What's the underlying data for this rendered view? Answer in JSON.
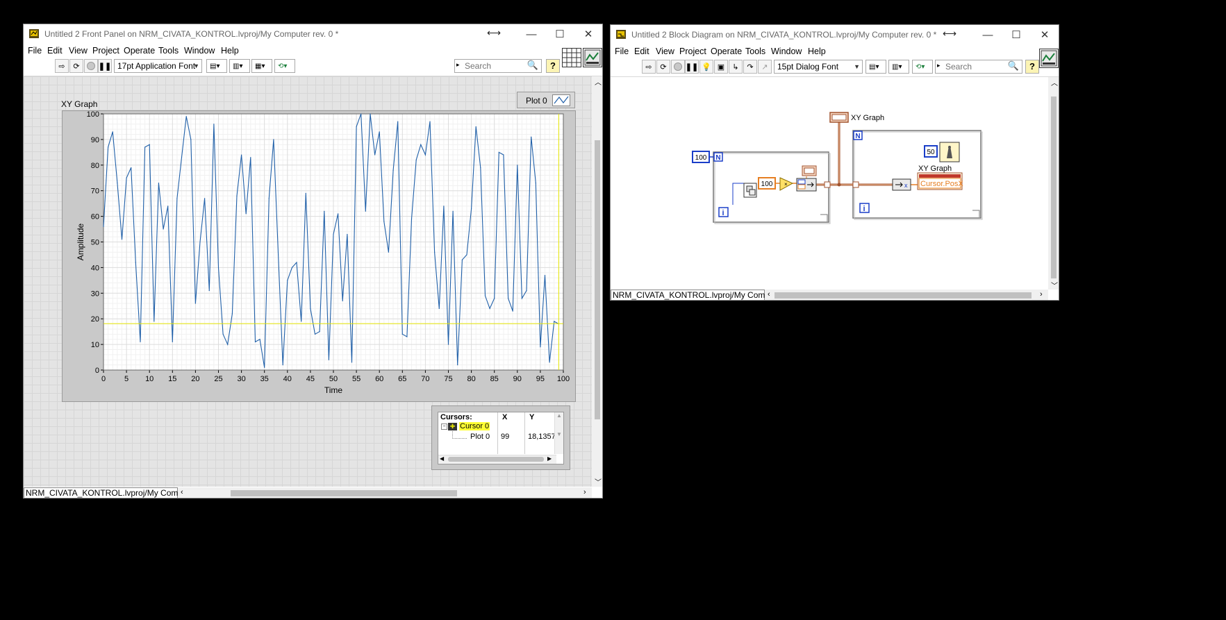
{
  "front_panel": {
    "title": "Untitled 2 Front Panel on NRM_CIVATA_KONTROL.lvproj/My Computer rev. 0 *",
    "menu": [
      "File",
      "Edit",
      "View",
      "Project",
      "Operate",
      "Tools",
      "Window",
      "Help"
    ],
    "font_dropdown": "17pt Application Font",
    "search_placeholder": "Search",
    "status_path": "NRM_CIVATA_KONTROL.lvproj/My Computer",
    "graph": {
      "caption": "XY Graph",
      "legend_plot": "Plot 0",
      "xlabel": "Time",
      "ylabel": "Amplitude",
      "cursor_x": 99,
      "cursor_y": 18.1357
    },
    "cursor_table": {
      "header": [
        "Cursors:",
        "X",
        "Y"
      ],
      "cursor_name": "Cursor 0",
      "plot_name": "Plot 0",
      "x_value": "99",
      "y_value": "18,1357"
    }
  },
  "block_diagram": {
    "title": "Untitled 2 Block Diagram on NRM_CIVATA_KONTROL.lvproj/My Computer rev. 0 *",
    "menu": [
      "File",
      "Edit",
      "View",
      "Project",
      "Operate",
      "Tools",
      "Window",
      "Help"
    ],
    "font_dropdown": "15pt Dialog Font",
    "search_placeholder": "Search",
    "status_path": "NRM_CIVATA_KONTROL.lvproj/My Computer",
    "loop1_count": "100",
    "loop_n": "N",
    "loop_i": "i",
    "multiplier_const": "100",
    "wait_const": "50",
    "graph_terminal_label": "XY Graph",
    "property_node_label": "XY Graph",
    "property_node_item": "Cursor.PosX"
  },
  "chart_data": {
    "type": "line",
    "xlabel": "Time",
    "ylabel": "Amplitude",
    "xlim": [
      0,
      100
    ],
    "ylim": [
      0,
      100
    ],
    "x_ticks": [
      0,
      5,
      10,
      15,
      20,
      25,
      30,
      35,
      40,
      45,
      50,
      55,
      60,
      65,
      70,
      75,
      80,
      85,
      90,
      95,
      100
    ],
    "y_ticks": [
      0,
      10,
      20,
      30,
      40,
      50,
      60,
      70,
      80,
      90,
      100
    ],
    "grid": true,
    "series": [
      {
        "name": "Plot 0",
        "color": "#1f5fa8",
        "x": [
          0,
          1,
          2,
          3,
          4,
          5,
          6,
          7,
          8,
          9,
          10,
          11,
          12,
          13,
          14,
          15,
          16,
          17,
          18,
          19,
          20,
          21,
          22,
          23,
          24,
          25,
          26,
          27,
          28,
          29,
          30,
          31,
          32,
          33,
          34,
          35,
          36,
          37,
          38,
          39,
          40,
          41,
          42,
          43,
          44,
          45,
          46,
          47,
          48,
          49,
          50,
          51,
          52,
          53,
          54,
          55,
          56,
          57,
          58,
          59,
          60,
          61,
          62,
          63,
          64,
          65,
          66,
          67,
          68,
          69,
          70,
          71,
          72,
          73,
          74,
          75,
          76,
          77,
          78,
          79,
          80,
          81,
          82,
          83,
          84,
          85,
          86,
          87,
          88,
          89,
          90,
          91,
          92,
          93,
          94,
          95,
          96,
          97,
          98,
          99
        ],
        "y": [
          56,
          87,
          93,
          73,
          51,
          75,
          79,
          42,
          11,
          87,
          88,
          19,
          73,
          55,
          64,
          11,
          67,
          83,
          99,
          90,
          26,
          50,
          67,
          31,
          96,
          40,
          14,
          10,
          22,
          68,
          84,
          61,
          83,
          11,
          12,
          1,
          67,
          90,
          45,
          2,
          35,
          40,
          42,
          19,
          69,
          24,
          14,
          15,
          62,
          4,
          53,
          61,
          27,
          53,
          3,
          95,
          100,
          62,
          100,
          84,
          93,
          58,
          46,
          78,
          97,
          14,
          13,
          59,
          82,
          88,
          84,
          97,
          46,
          24,
          64,
          10,
          62,
          2,
          43,
          45,
          63,
          95,
          79,
          29,
          24,
          28,
          85,
          84,
          28,
          23,
          80,
          28,
          31,
          91,
          73,
          9,
          37,
          3,
          19,
          18
        ]
      }
    ],
    "cursor": {
      "name": "Cursor 0",
      "x": 99,
      "y": 18.1357,
      "color": "#e6e600"
    }
  }
}
